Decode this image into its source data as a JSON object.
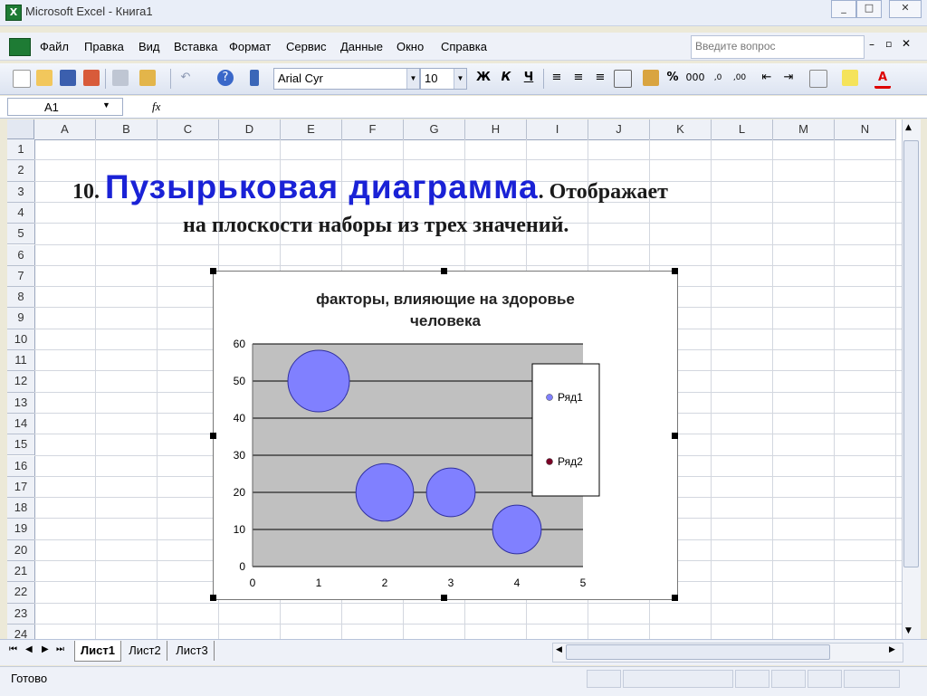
{
  "window": {
    "title": "Microsoft Excel - Книга1",
    "app_icon": "X",
    "buttons": [
      "_",
      "□",
      "✕"
    ]
  },
  "menu": {
    "items": [
      "Файл",
      "Правка",
      "Вид",
      "Вставка",
      "Формат",
      "Сервис",
      "Данные",
      "Окно",
      "Справка"
    ],
    "help_placeholder": "Введите вопрос"
  },
  "toolbar": {
    "font_name": "Arial Cyr",
    "font_size": "10",
    "bold": "Ж",
    "italic": "К",
    "underline": "Ч",
    "percent": "%",
    "thousands": "000"
  },
  "formula_bar": {
    "name_box": "A1",
    "fx_label": "fx",
    "value": ""
  },
  "sheet": {
    "columns": [
      "A",
      "B",
      "C",
      "D",
      "E",
      "F",
      "G",
      "H",
      "I",
      "J",
      "K",
      "L",
      "M",
      "N"
    ],
    "rows": [
      "1",
      "2",
      "3",
      "4",
      "5",
      "6",
      "7",
      "8",
      "9",
      "10",
      "11",
      "12",
      "13",
      "14",
      "15",
      "16",
      "17",
      "18",
      "19",
      "20",
      "21",
      "22",
      "23",
      "24"
    ]
  },
  "overlay": {
    "number": "10.",
    "title": "Пузырьковая диаграмма",
    "rest_line1": ". Отображает",
    "line2": "на плоскости наборы из трех значений."
  },
  "colors": {
    "title_blue": "#1a22d6",
    "bubble_fill": "#8080ff",
    "series2_marker": "#7a0026",
    "plot_bg": "#c0c0c0"
  },
  "chart_data": {
    "type": "bubble",
    "title": "факторы, влияющие на здоровье человека",
    "title_lines": [
      "факторы, влияющие на здоровье",
      "человека"
    ],
    "xlim": [
      0,
      5
    ],
    "ylim": [
      0,
      60
    ],
    "x_ticks": [
      "0",
      "1",
      "2",
      "3",
      "4",
      "5"
    ],
    "y_ticks": [
      "0",
      "10",
      "20",
      "30",
      "40",
      "50",
      "60"
    ],
    "grid": true,
    "legend_position": "right",
    "series": [
      {
        "name": "Ряд1",
        "color": "#8080ff",
        "points": [
          {
            "x": 1,
            "y": 50,
            "size": 1.6
          },
          {
            "x": 2,
            "y": 20,
            "size": 1.4
          },
          {
            "x": 3,
            "y": 20,
            "size": 1.0
          },
          {
            "x": 4,
            "y": 10,
            "size": 1.0
          }
        ]
      },
      {
        "name": "Ряд2",
        "color": "#7a0026",
        "points": []
      }
    ]
  },
  "sheet_tabs": {
    "tabs": [
      "Лист1",
      "Лист2",
      "Лист3"
    ],
    "active": "Лист1"
  },
  "status": {
    "text": "Готово"
  }
}
